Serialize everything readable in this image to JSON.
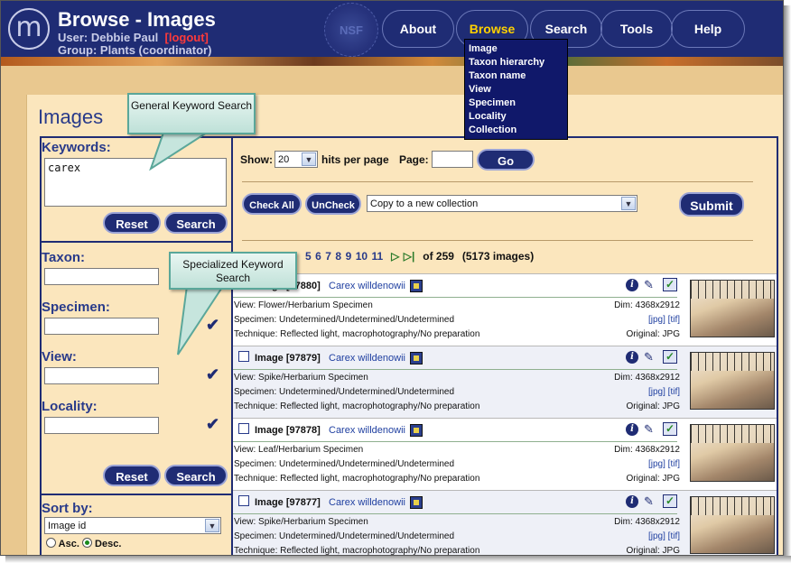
{
  "app": {
    "title": "Browse - Images",
    "user_label": "User: Debbie Paul",
    "logout": "[logout]",
    "group": "Group: Plants (coordinator)",
    "logo_letter": "m",
    "seal_text": "NSF"
  },
  "nav": {
    "items": [
      "About",
      "Browse",
      "Search",
      "Tools",
      "Help"
    ],
    "active": "Browse",
    "dropdown": [
      "Image",
      "Taxon hierarchy",
      "Taxon name",
      "View",
      "Specimen",
      "Locality",
      "Collection"
    ]
  },
  "page": {
    "title": "Images"
  },
  "sidebar": {
    "keywords_label": "Keywords:",
    "keywords_value": "carex",
    "reset": "Reset",
    "search": "Search",
    "taxon_label": "Taxon:",
    "specimen_label": "Specimen:",
    "view_label": "View:",
    "locality_label": "Locality:",
    "sort_label": "Sort by:",
    "sort_value": "Image id",
    "asc": "Asc.",
    "desc": "Desc.",
    "sort_order": "desc"
  },
  "controls": {
    "show_label": "Show:",
    "hits_value": "20",
    "hits_suffix": "hits per page",
    "page_label": "Page:",
    "go": "Go",
    "check_all": "Check All",
    "uncheck": "UnCheck",
    "collection_action": "Copy to a new collection",
    "submit": "Submit"
  },
  "pager": {
    "pages": [
      "5",
      "6",
      "7",
      "8",
      "9",
      "10",
      "11"
    ],
    "next_symbol": "▷",
    "last_symbol": "▷|",
    "summary": "of 259",
    "count": "(5173 images)"
  },
  "results": [
    {
      "title": "Image [97880]",
      "taxon": "Carex willdenowii",
      "view": "View: Flower/Herbarium Specimen",
      "specimen": "Specimen: Undetermined/Undetermined/Undetermined",
      "technique": "Technique: Reflected light, macrophotography/No preparation",
      "dim": "Dim: 4368x2912",
      "links": "[jpg]  [tif]",
      "original": "Original: JPG"
    },
    {
      "title": "Image [97879]",
      "taxon": "Carex willdenowii",
      "view": "View: Spike/Herbarium Specimen",
      "specimen": "Specimen: Undetermined/Undetermined/Undetermined",
      "technique": "Technique: Reflected light, macrophotography/No preparation",
      "dim": "Dim: 4368x2912",
      "links": "[jpg]  [tif]",
      "original": "Original: JPG"
    },
    {
      "title": "Image [97878]",
      "taxon": "Carex willdenowii",
      "view": "View: Leaf/Herbarium Specimen",
      "specimen": "Specimen: Undetermined/Undetermined/Undetermined",
      "technique": "Technique: Reflected light, macrophotography/No preparation",
      "dim": "Dim: 4368x2912",
      "links": "[jpg]  [tif]",
      "original": "Original: JPG"
    },
    {
      "title": "Image [97877]",
      "taxon": "Carex willdenowii",
      "view": "View: Spike/Herbarium Specimen",
      "specimen": "Specimen: Undetermined/Undetermined/Undetermined",
      "technique": "Technique: Reflected light, macrophotography/No preparation",
      "dim": "Dim: 4368x2912",
      "links": "[jpg]  [tif]",
      "original": "Original: JPG"
    }
  ],
  "callouts": {
    "general": "General Keyword Search",
    "specialized": "Specialized Keyword Search"
  },
  "colors": {
    "header": "#1f2c74",
    "active_nav": "#ffd100",
    "page_bg": "#fbe6bd",
    "link": "#1f3fa0"
  }
}
